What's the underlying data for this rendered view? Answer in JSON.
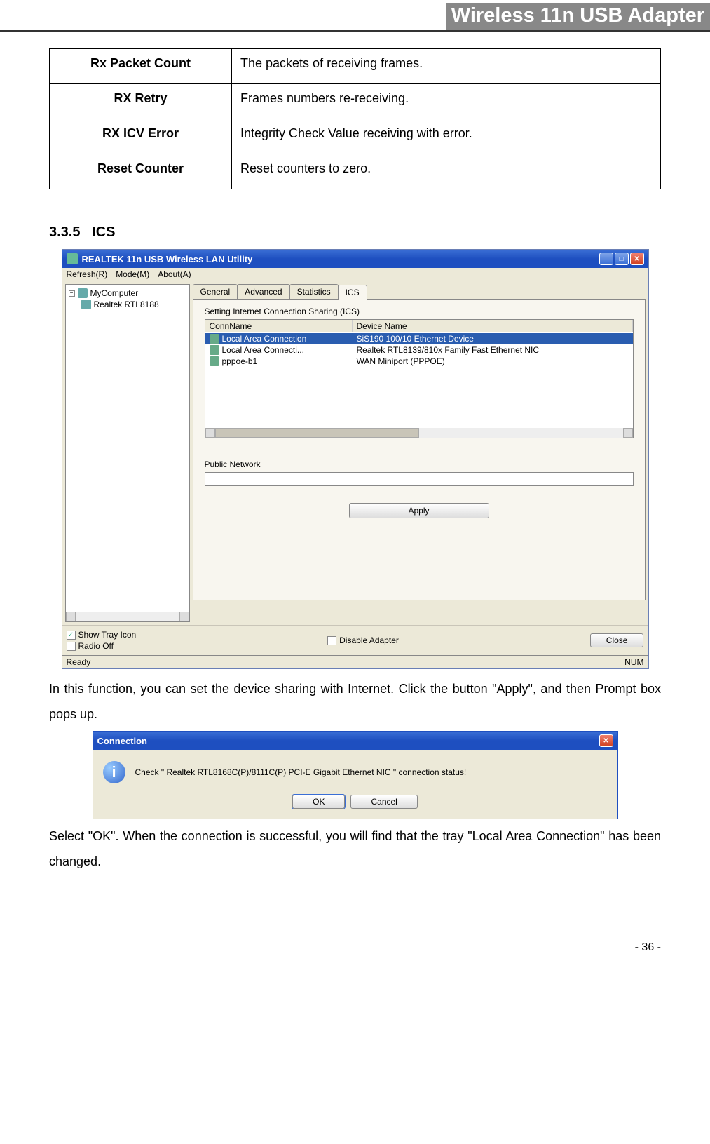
{
  "header": {
    "title": "Wireless 11n USB Adapter"
  },
  "def_table": [
    {
      "label": "Rx Packet Count",
      "desc": "The packets of receiving frames."
    },
    {
      "label": "RX Retry",
      "desc": "Frames numbers re-receiving."
    },
    {
      "label": "RX ICV Error",
      "desc": "Integrity Check Value receiving with error."
    },
    {
      "label": "Reset Counter",
      "desc": "Reset counters to zero."
    }
  ],
  "section": {
    "number": "3.3.5",
    "title": "ICS"
  },
  "app": {
    "title": "REALTEK 11n USB Wireless LAN Utility",
    "menus": {
      "refresh": "Refresh(R)",
      "mode": "Mode(M)",
      "about": "About(A)"
    },
    "tree": {
      "root": "MyComputer",
      "child": "Realtek RTL8188"
    },
    "tabs": {
      "general": "General",
      "advanced": "Advanced",
      "statistics": "Statistics",
      "ics": "ICS"
    },
    "ics": {
      "heading": "Setting Internet Connection Sharing (ICS)",
      "col_conn": "ConnName",
      "col_device": "Device Name",
      "rows": [
        {
          "conn": "Local Area Connection",
          "device": "SiS190 100/10 Ethernet Device",
          "selected": true
        },
        {
          "conn": "Local Area Connecti...",
          "device": "Realtek RTL8139/810x Family Fast Ethernet NIC",
          "selected": false
        },
        {
          "conn": "pppoe-b1",
          "device": "WAN Miniport (PPPOE)",
          "selected": false
        }
      ],
      "public_label": "Public Network",
      "apply": "Apply"
    },
    "bottom": {
      "show_tray": "Show Tray Icon",
      "radio_off": "Radio Off",
      "disable_adapter": "Disable Adapter",
      "close": "Close"
    },
    "status": {
      "left": "Ready",
      "right": "NUM"
    }
  },
  "paragraph1": "In this function, you can set the device sharing with Internet. Click the button \"Apply\", and then Prompt box pops up.",
  "dialog": {
    "title": "Connection",
    "message": "Check \" Realtek RTL8168C(P)/8111C(P) PCI-E Gigabit Ethernet NIC \" connection status!",
    "ok": "OK",
    "cancel": "Cancel"
  },
  "paragraph2": "Select \"OK\". When the connection is successful, you will find that the tray \"Local Area Connection\" has been changed.",
  "page_number": "- 36 -"
}
